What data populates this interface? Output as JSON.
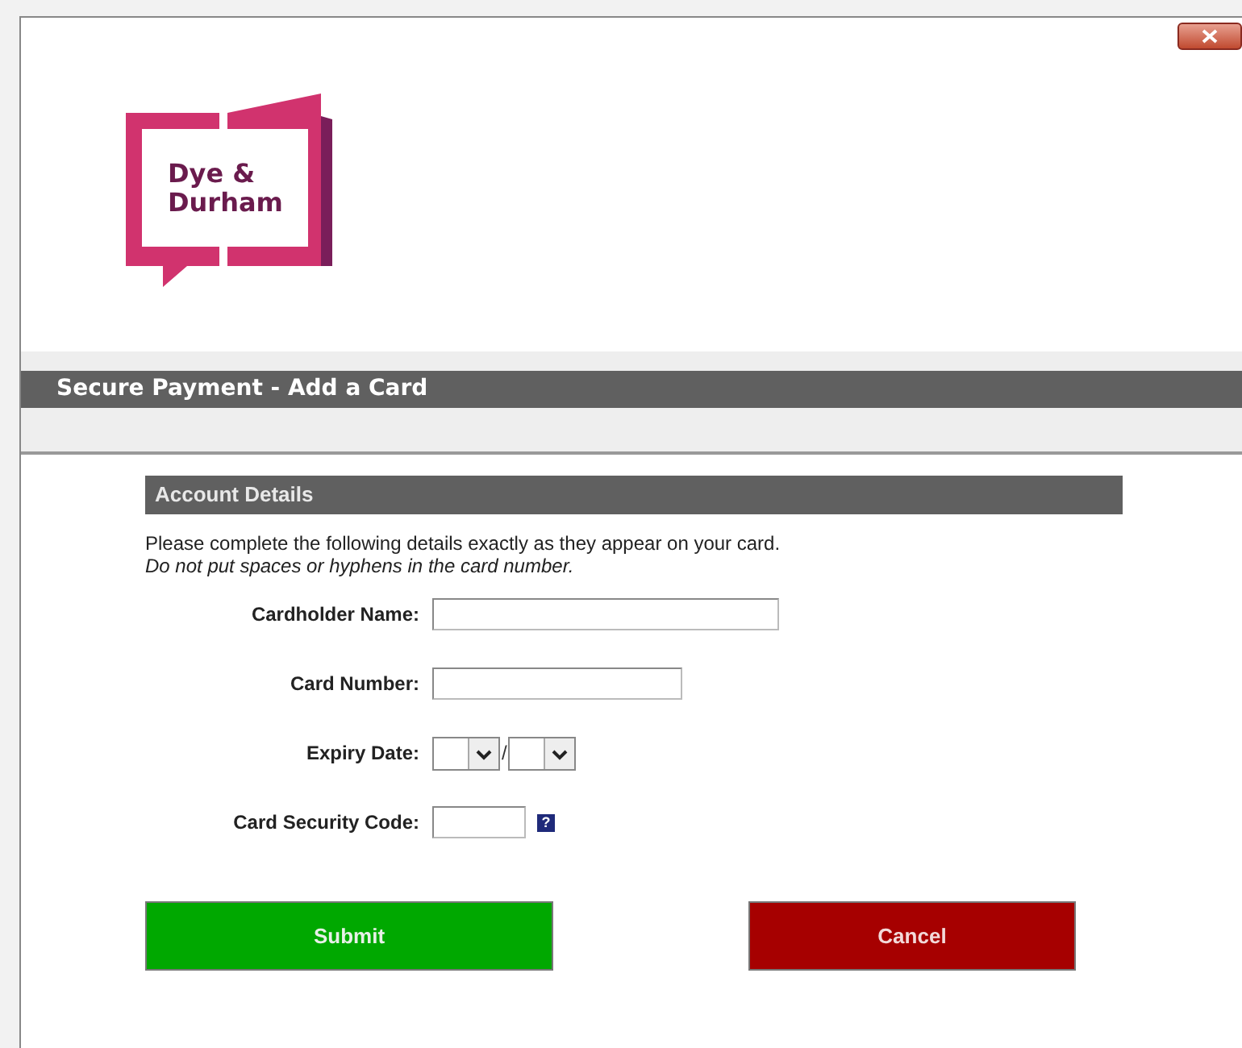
{
  "logo": {
    "lines": [
      "Dye &",
      "Durham"
    ]
  },
  "title_bar": {
    "title": "Secure Payment - Add a Card"
  },
  "section": {
    "title": "Account Details",
    "instructions": "Please complete the following details exactly as they appear on your card.",
    "note": "Do not put spaces or hyphens in the card number."
  },
  "fields": [
    {
      "kind": "name",
      "label": "Cardholder Name:"
    },
    {
      "kind": "number",
      "label": "Card Number:"
    },
    {
      "kind": "expiry",
      "label": "Expiry Date:",
      "separator": "/"
    },
    {
      "kind": "code",
      "label": "Card Security Code:",
      "help": "?"
    }
  ],
  "buttons": [
    {
      "label": "Submit",
      "kind": "primary"
    },
    {
      "label": "Cancel",
      "kind": "danger"
    }
  ]
}
